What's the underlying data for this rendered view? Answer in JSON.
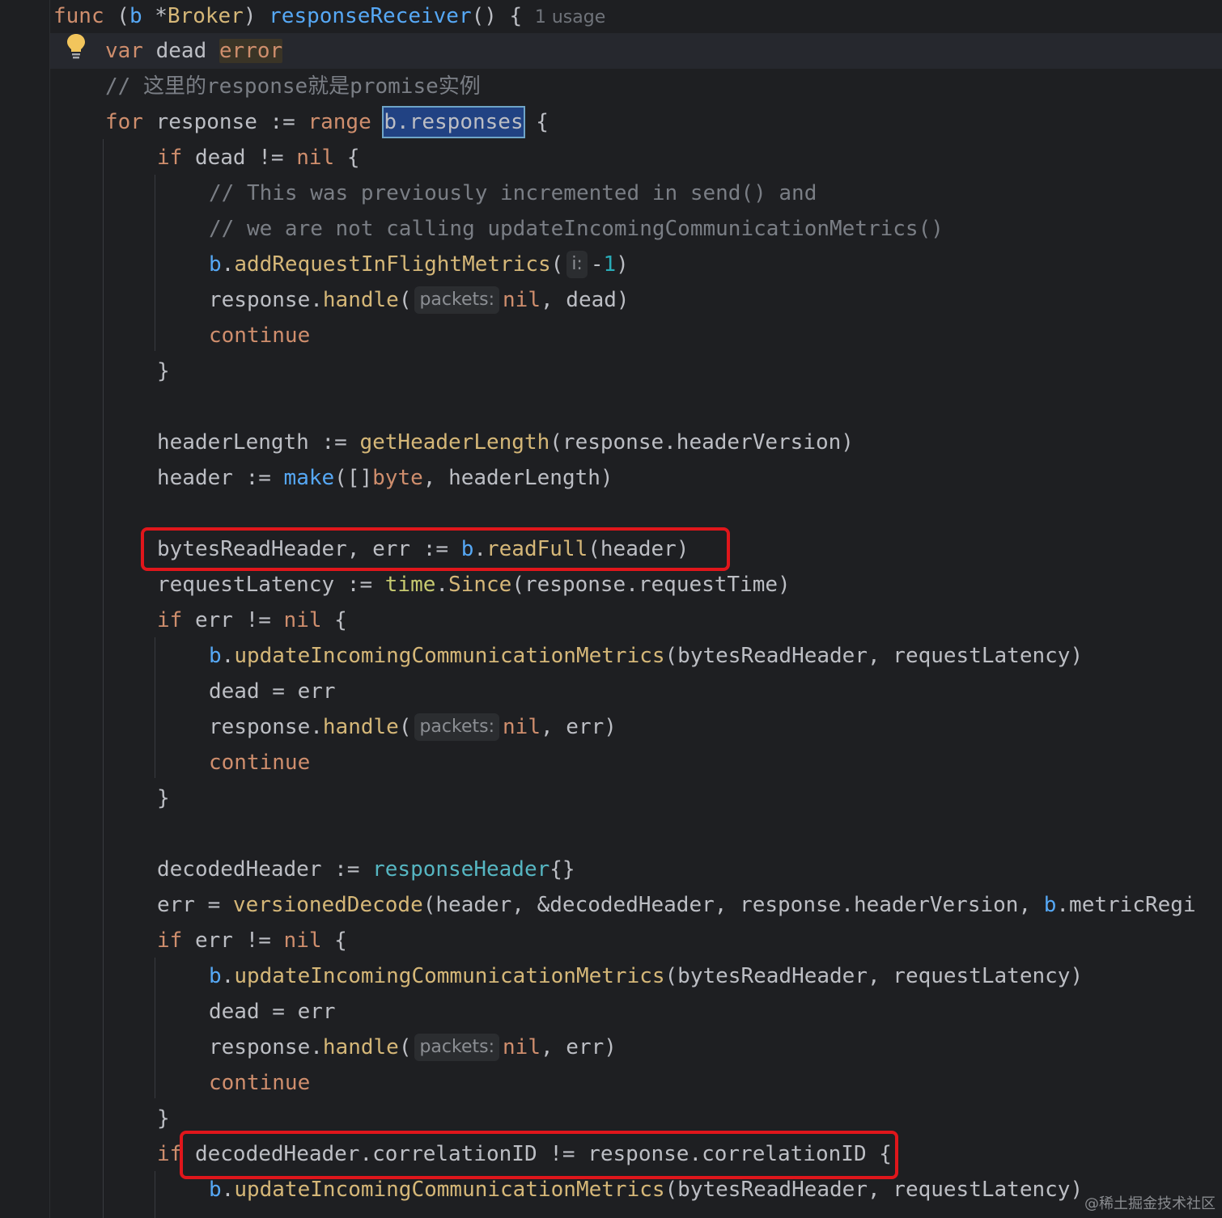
{
  "editor": {
    "usage_hint": "1 usage",
    "hint_i": "i:",
    "hint_packets": "packets:",
    "watermark": "@稀土掘金技术社区",
    "colors": {
      "background": "#1e1f22",
      "keyword": "#cf8e6d",
      "function": "#56a8f5",
      "comment": "#7a7e85",
      "highlight_box": "#e0161b"
    },
    "icon": "lightbulb-icon"
  },
  "code": {
    "l1": {
      "func": "func",
      "open": " (",
      "recv": "b",
      "star": " *",
      "type": "Broker",
      "close": ") ",
      "name": "responseReceiver",
      "rest": "() { "
    },
    "l2": {
      "kw": "var",
      "mid": " dead ",
      "type": "error"
    },
    "l3": {
      "text": "// 这里的response就是promise实例"
    },
    "l4": {
      "kw": "for",
      "a": " response := ",
      "range": "range",
      "sp": " ",
      "sel": "b.responses",
      "end": " {"
    },
    "l5": {
      "kw": "if",
      "a": " dead != ",
      "nil": "nil",
      "end": " {"
    },
    "l6": {
      "text": "// This was previously incremented in send() and"
    },
    "l7": {
      "text": "// we are not calling updateIncomingCommunicationMetrics()"
    },
    "l8": {
      "recv": "b",
      "dot": ".",
      "method": "addRequestInFlightMetrics",
      "open": "(",
      "neg": "-",
      "num": "1",
      "close": ")"
    },
    "l9": {
      "a": "response.",
      "method": "handle",
      "open": "(",
      "nil": "nil",
      "rest": ", dead)"
    },
    "l10": {
      "kw": "continue"
    },
    "l11": {
      "text": "}"
    },
    "l12": {
      "a": "headerLength := ",
      "call": "getHeaderLength",
      "rest": "(response.headerVersion)"
    },
    "l13": {
      "a": "header := ",
      "make": "make",
      "b": "([]",
      "byte": "byte",
      "rest": ", headerLength)"
    },
    "l14": {
      "a": "bytesReadHeader, err := ",
      "recv": "b",
      "dot": ".",
      "method": "readFull",
      "rest": "(header)"
    },
    "l15": {
      "a": "requestLatency := ",
      "pkg": "time",
      "dot": ".",
      "method": "Since",
      "rest": "(response.requestTime)"
    },
    "l16": {
      "kw": "if",
      "a": " err != ",
      "nil": "nil",
      "end": " {"
    },
    "l17": {
      "recv": "b",
      "dot": ".",
      "method": "updateIncomingCommunicationMetrics",
      "rest": "(bytesReadHeader, requestLatency)"
    },
    "l18": {
      "text": "dead = err"
    },
    "l19": {
      "a": "response.",
      "method": "handle",
      "open": "(",
      "nil": "nil",
      "rest": ", err)"
    },
    "l20": {
      "kw": "continue"
    },
    "l21": {
      "text": "}"
    },
    "l22": {
      "a": "decodedHeader := ",
      "ctor": "responseHeader",
      "rest": "{}"
    },
    "l23": {
      "a": "err = ",
      "call": "versionedDecode",
      "b": "(header, &decodedHeader, response.headerVersion, ",
      "recv": "b",
      "rest": ".metricRegi"
    },
    "l24": {
      "kw": "if",
      "a": " err != ",
      "nil": "nil",
      "end": " {"
    },
    "l25": {
      "recv": "b",
      "dot": ".",
      "method": "updateIncomingCommunicationMetrics",
      "rest": "(bytesReadHeader, requestLatency)"
    },
    "l26": {
      "text": "dead = err"
    },
    "l27": {
      "a": "response.",
      "method": "handle",
      "open": "(",
      "nil": "nil",
      "rest": ", err)"
    },
    "l28": {
      "kw": "continue"
    },
    "l29": {
      "text": "}"
    },
    "l30": {
      "kw": "if",
      "a": " decodedHeader.correlationID != response.correlationID {"
    },
    "l31": {
      "recv": "b",
      "dot": ".",
      "method": "updateIncomingCommunicationMetrics",
      "rest": "(bytesReadHeader, requestLatency)"
    }
  }
}
